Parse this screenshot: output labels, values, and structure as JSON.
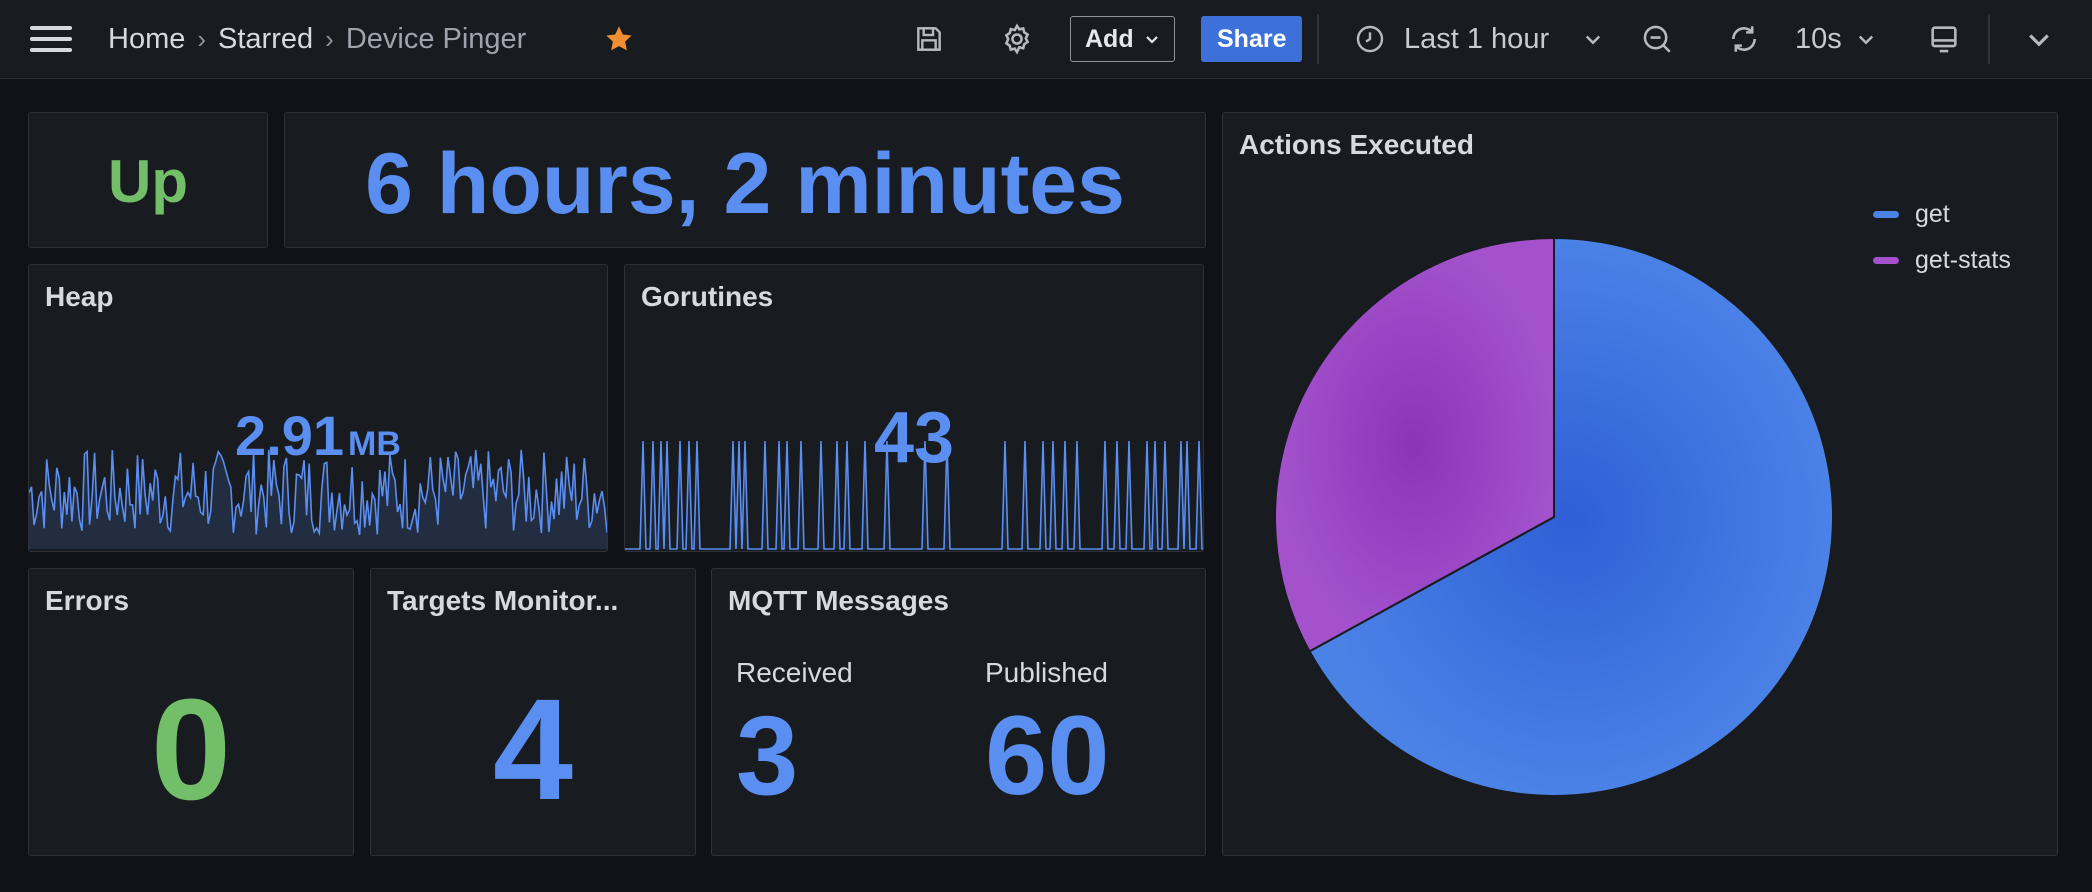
{
  "breadcrumb": {
    "home": "Home",
    "starred": "Starred",
    "current": "Device Pinger"
  },
  "toolbar": {
    "add_label": "Add",
    "share_label": "Share",
    "time_range": "Last 1 hour",
    "refresh_interval": "10s"
  },
  "panels": {
    "status": {
      "value": "Up",
      "color": "#73bf69"
    },
    "uptime": {
      "value": "6 hours, 2 minutes",
      "color": "#5a8ef0"
    },
    "heap": {
      "title": "Heap",
      "value": "2.91",
      "unit": "MB"
    },
    "goroutines": {
      "title": "Gorutines",
      "value": "43"
    },
    "errors": {
      "title": "Errors",
      "value": "0",
      "color": "#73bf69"
    },
    "targets": {
      "title": "Targets Monitor...",
      "value": "4"
    },
    "mqtt": {
      "title": "MQTT Messages",
      "received_label": "Received",
      "received_value": "3",
      "published_label": "Published",
      "published_value": "60"
    }
  },
  "colors": {
    "blue": "#5a8ef0",
    "green": "#73bf69",
    "purple": "#a352cc",
    "accent": "#3d71d9",
    "star": "#f08e33"
  },
  "chart_data": {
    "type": "pie",
    "title": "Actions Executed",
    "series": [
      {
        "name": "get",
        "value": 67,
        "color": "#4b82e6"
      },
      {
        "name": "get-stats",
        "value": 33,
        "color": "#a352cc"
      }
    ],
    "legend_position": "top-right"
  }
}
